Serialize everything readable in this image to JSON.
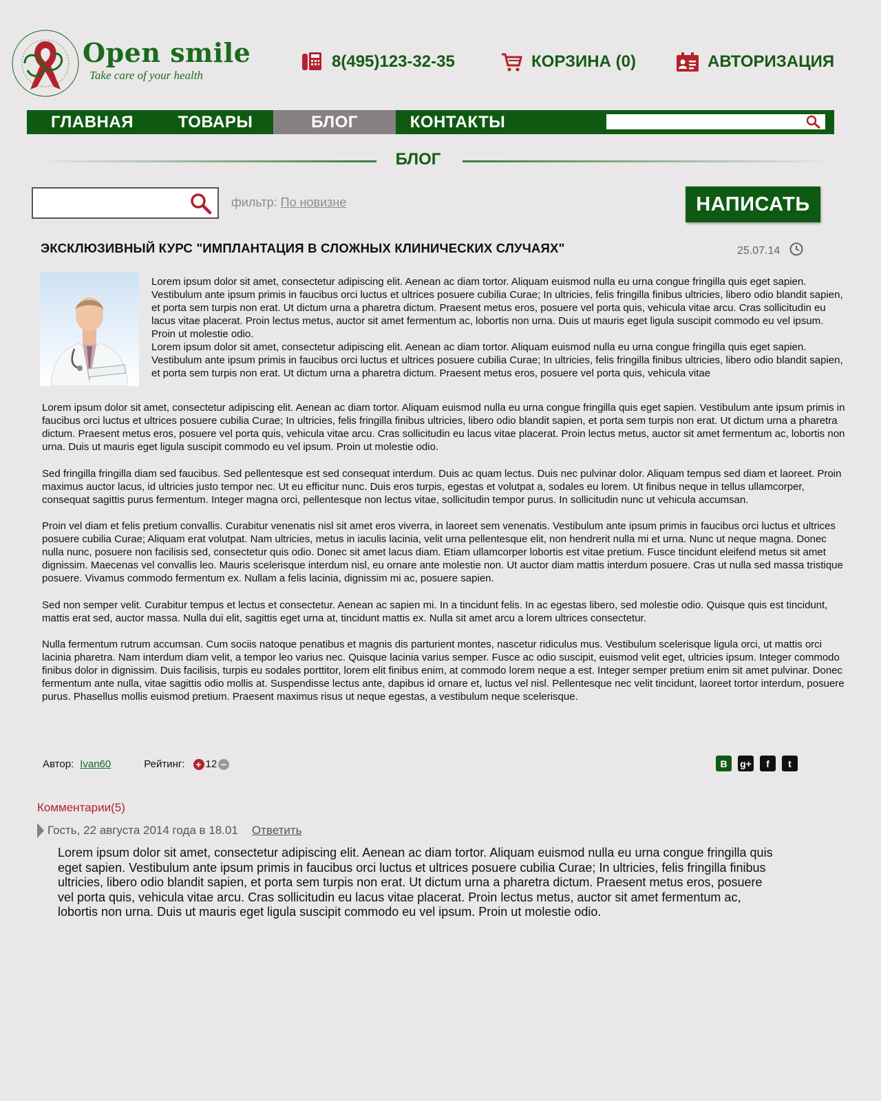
{
  "logo": {
    "title": "Open smile",
    "tagline": "Take care of your health",
    "seal_text_top": "Take care of your health",
    "seal_text_bottom": "Great dentist association"
  },
  "header": {
    "phone": "8(495)123-32-35",
    "cart": "КОРЗИНА (0)",
    "auth": "АВТОРИЗАЦИЯ"
  },
  "nav": {
    "items": [
      {
        "label": "ГЛАВНАЯ",
        "active": false
      },
      {
        "label": "ТОВАРЫ",
        "active": false
      },
      {
        "label": "БЛОГ",
        "active": true
      },
      {
        "label": "КОНТАКТЫ",
        "active": false
      }
    ],
    "search_value": ""
  },
  "section": {
    "title": "БЛОГ"
  },
  "toolbar": {
    "search_value": "",
    "filter_label": "фильтр:",
    "filter_value": "По новизне",
    "write_label": "НАПИСАТЬ"
  },
  "post": {
    "title": "ЭКСКЛЮЗИВНЫЙ КУРС \"ИМПЛАНТАЦИЯ В СЛОЖНЫХ КЛИНИЧЕСКИХ СЛУЧАЯХ\"",
    "date": "25.07.14",
    "intro_1": "Lorem ipsum dolor sit amet, consectetur adipiscing elit. Aenean ac diam tortor. Aliquam euismod nulla eu urna congue fringilla quis eget sapien. Vestibulum ante ipsum primis in faucibus orci luctus et ultrices posuere cubilia Curae; In ultricies, felis fringilla finibus ultricies, libero odio blandit sapien, et porta sem turpis non erat. Ut dictum urna a pharetra dictum. Praesent metus eros, posuere vel porta quis, vehicula vitae arcu. Cras sollicitudin eu lacus vitae placerat. Proin lectus metus, auctor sit amet fermentum ac, lobortis non urna. Duis ut mauris eget ligula suscipit commodo eu vel ipsum. Proin ut molestie odio.",
    "intro_2": "Lorem ipsum dolor sit amet, consectetur adipiscing elit. Aenean ac diam tortor. Aliquam euismod nulla eu urna congue fringilla quis eget sapien. Vestibulum ante ipsum primis in faucibus orci luctus et ultrices posuere cubilia Curae; In ultricies, felis fringilla finibus ultricies, libero odio blandit sapien, et porta sem turpis non erat. Ut dictum urna a pharetra dictum. Praesent metus eros, posuere vel porta quis, vehicula vitae",
    "paragraphs": [
      "Lorem ipsum dolor sit amet, consectetur adipiscing elit. Aenean ac diam tortor. Aliquam euismod nulla eu urna congue fringilla quis eget sapien. Vestibulum ante ipsum primis in faucibus orci luctus et ultrices posuere cubilia Curae; In ultricies, felis fringilla finibus ultricies, libero odio blandit sapien, et porta sem turpis non erat. Ut dictum urna a pharetra dictum. Praesent metus eros, posuere vel porta quis, vehicula vitae arcu. Cras sollicitudin eu lacus vitae placerat. Proin lectus metus, auctor sit amet fermentum ac, lobortis non urna. Duis ut mauris eget ligula suscipit commodo eu vel ipsum. Proin ut molestie odio.",
      "Sed fringilla fringilla diam sed faucibus. Sed pellentesque est sed consequat interdum. Duis ac quam lectus. Duis nec pulvinar dolor. Aliquam tempus sed diam et laoreet. Proin maximus auctor lacus, id ultricies justo tempor nec. Ut eu efficitur nunc. Duis eros turpis, egestas et volutpat a, sodales eu lorem. Ut finibus neque in tellus ullamcorper, consequat sagittis purus fermentum. Integer magna orci, pellentesque non lectus vitae, sollicitudin tempor purus. In sollicitudin nunc ut vehicula accumsan.",
      "Proin vel diam et felis pretium convallis. Curabitur venenatis nisl sit amet eros viverra, in laoreet sem venenatis. Vestibulum ante ipsum primis in faucibus orci luctus et ultrices posuere cubilia Curae; Aliquam erat volutpat. Nam ultricies, metus in iaculis lacinia, velit urna pellentesque elit, non hendrerit nulla mi et urna. Nunc ut neque magna. Donec nulla nunc, posuere non facilisis sed, consectetur quis odio. Donec sit amet lacus diam. Etiam ullamcorper lobortis est vitae pretium. Fusce tincidunt eleifend metus sit amet dignissim. Maecenas vel convallis leo. Mauris scelerisque interdum nisl, eu ornare ante molestie non. Ut auctor diam mattis interdum posuere. Cras ut nulla sed massa tristique posuere. Vivamus commodo fermentum ex. Nullam a felis lacinia, dignissim mi ac, posuere sapien.",
      "Sed non semper velit. Curabitur tempus et lectus et consectetur. Aenean ac sapien mi. In a tincidunt felis. In ac egestas libero, sed molestie odio. Quisque quis est tincidunt, mattis erat sed, auctor massa. Nulla dui elit, sagittis eget urna at, tincidunt mattis ex. Nulla sit amet arcu a lorem ultrices consectetur.",
      "Nulla fermentum rutrum accumsan. Cum sociis natoque penatibus et magnis dis parturient montes, nascetur ridiculus mus. Vestibulum scelerisque ligula orci, ut mattis orci lacinia pharetra. Nam interdum diam velit, a tempor leo varius nec. Quisque lacinia varius semper. Fusce ac odio suscipit, euismod velit eget, ultricies ipsum. Integer commodo finibus dolor in dignissim. Duis facilisis, turpis eu sodales porttitor, lorem elit finibus enim, at commodo lorem neque a est. Integer semper pretium enim sit amet pulvinar. Donec fermentum ante nulla, vitae sagittis odio mollis at. Suspendisse lectus ante, dapibus id ornare et, luctus vel nisl. Pellentesque nec velit tincidunt, laoreet tortor interdum, posuere purus. Phasellus mollis euismod pretium. Praesent maximus risus ut neque egestas, a vestibulum neque scelerisque."
    ],
    "author_label": "Автор:",
    "author": "Ivan60",
    "rating_label": "Рейтинг:",
    "rating": "12",
    "social": [
      "В",
      "g+",
      "f",
      "t"
    ]
  },
  "comments": {
    "title": "Комментарии(5)",
    "items": [
      {
        "header": "Гость, 22 августа 2014 года в 18.01",
        "reply": "Ответить",
        "text": "Lorem ipsum dolor sit amet, consectetur adipiscing elit. Aenean ac diam tortor. Aliquam euismod nulla eu urna congue fringilla quis eget sapien. Vestibulum ante ipsum primis in faucibus orci luctus et ultrices posuere cubilia Curae; In ultricies, felis fringilla finibus ultricies, libero odio blandit sapien, et porta sem turpis non erat. Ut dictum urna a pharetra dictum. Praesent metus eros, posuere vel porta quis, vehicula vitae arcu. Cras sollicitudin eu lacus vitae placerat. Proin lectus metus, auctor sit amet fermentum ac, lobortis non urna. Duis ut mauris eget ligula suscipit commodo eu vel ipsum. Proin ut molestie odio."
      }
    ]
  },
  "colors": {
    "brand_green": "#0f5a12",
    "accent_red": "#b3212c",
    "active_tab": "#878183",
    "background": "#e9e7e8"
  }
}
